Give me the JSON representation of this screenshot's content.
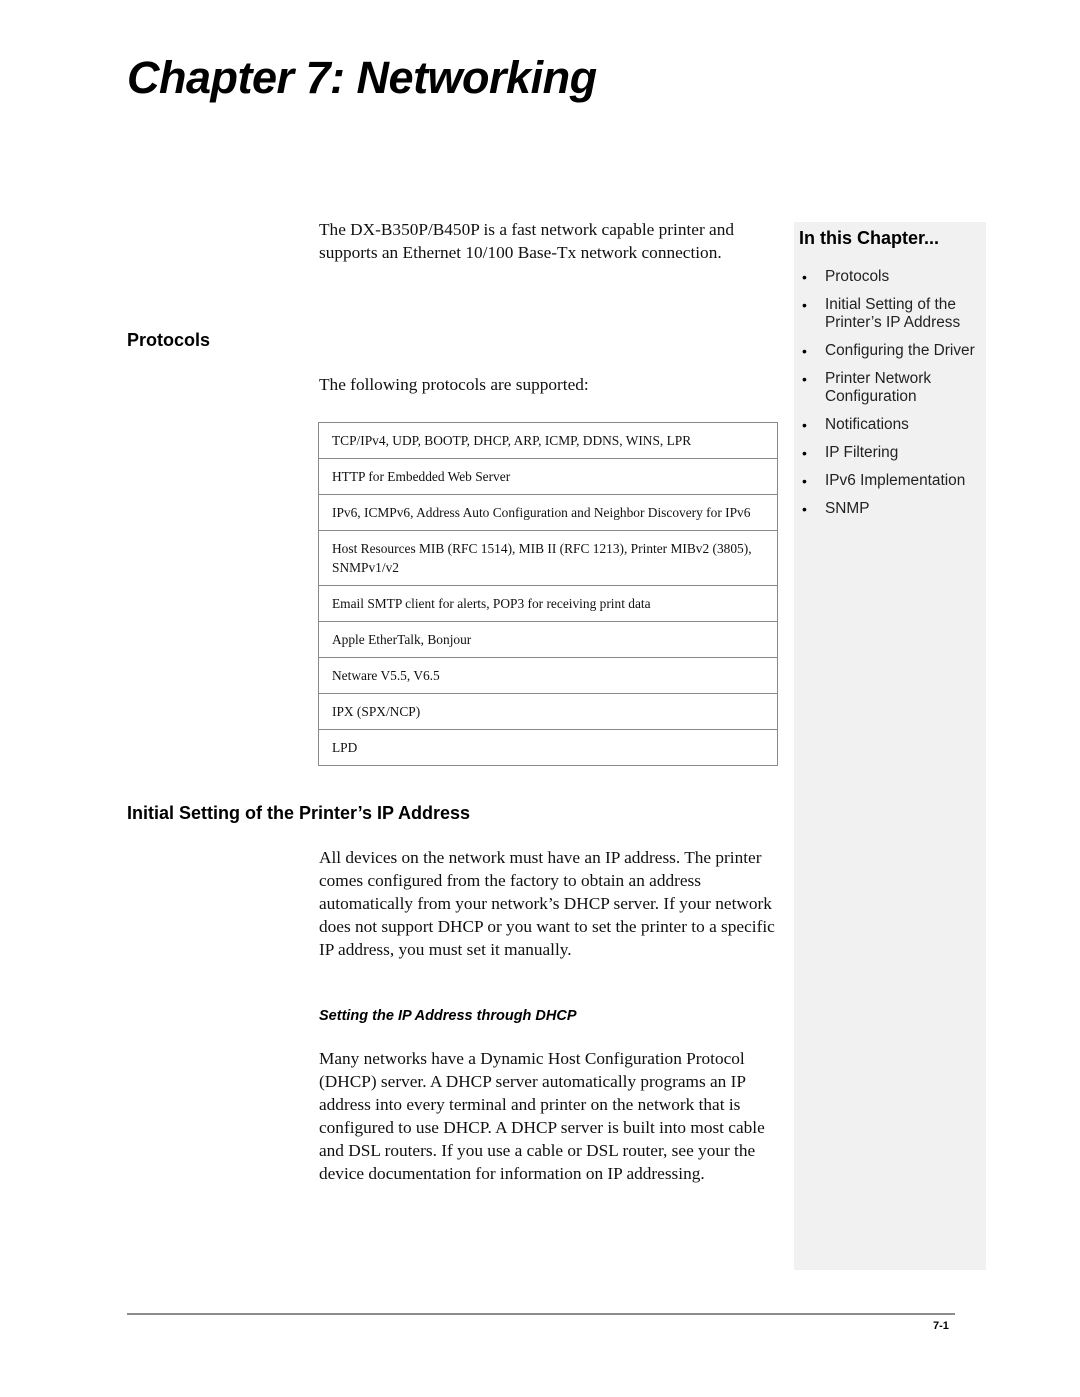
{
  "chapter": {
    "title": "Chapter 7: Networking"
  },
  "intro": "The DX-B350P/B450P is a fast network capable printer and supports an Ethernet 10/100 Base-Tx network connection.",
  "protocols": {
    "heading": "Protocols",
    "intro": "The following protocols are supported:",
    "rows": [
      "TCP/IPv4, UDP, BOOTP, DHCP, ARP, ICMP, DDNS, WINS, LPR",
      "HTTP for Embedded Web Server",
      "IPv6, ICMPv6, Address Auto Configuration and Neighbor Discovery for IPv6",
      "Host Resources MIB (RFC 1514), MIB II (RFC 1213), Printer MIBv2 (3805), SNMPv1/v2",
      "Email SMTP client for alerts, POP3 for receiving print data",
      "Apple EtherTalk, Bonjour",
      "Netware V5.5, V6.5",
      "IPX (SPX/NCP)",
      "LPD"
    ]
  },
  "ip_section": {
    "heading": "Initial Setting of the Printer’s IP Address",
    "paragraph": "All devices on the network must have an IP address. The printer comes configured from the factory to obtain an address automatically from your network’s DHCP server. If your network does not support DHCP or you want to set the printer to a specific IP address, you must set it manually.",
    "subheading": "Setting the IP Address through DHCP",
    "dhcp_paragraph": "Many networks have a Dynamic Host Configuration Protocol (DHCP) server. A DHCP server automatically programs an IP address into every terminal and printer on the network that is configured to use DHCP. A DHCP server is built into most cable and DSL routers. If you use a cable or DSL router, see your the device documentation for information on IP addressing."
  },
  "sidebar": {
    "title": "In this Chapter...",
    "bullet": "•",
    "items": [
      "Protocols",
      "Initial Setting of the Printer’s IP Address",
      "Configuring the Driver",
      "Printer Network Configuration",
      "Notifications",
      "IP Filtering",
      "IPv6 Implementation",
      "SNMP"
    ]
  },
  "footer": {
    "page_number": "7-1"
  }
}
